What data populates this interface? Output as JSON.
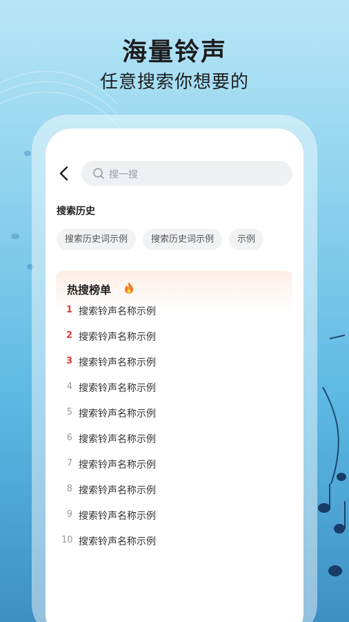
{
  "headline": "海量铃声",
  "subline": "任意搜索你想要的",
  "search": {
    "placeholder": "搜一搜"
  },
  "history": {
    "title": "搜索历史",
    "items": [
      "搜索历史词示例",
      "搜索历史词示例",
      "示例"
    ]
  },
  "hot": {
    "title": "热搜榜单",
    "items": [
      {
        "rank": "1",
        "name": "搜索铃声名称示例"
      },
      {
        "rank": "2",
        "name": "搜索铃声名称示例"
      },
      {
        "rank": "3",
        "name": "搜索铃声名称示例"
      },
      {
        "rank": "4",
        "name": "搜索铃声名称示例"
      },
      {
        "rank": "5",
        "name": "搜索铃声名称示例"
      },
      {
        "rank": "6",
        "name": "搜索铃声名称示例"
      },
      {
        "rank": "7",
        "name": "搜索铃声名称示例"
      },
      {
        "rank": "8",
        "name": "搜索铃声名称示例"
      },
      {
        "rank": "9",
        "name": "搜索铃声名称示例"
      },
      {
        "rank": "10",
        "name": "搜索铃声名称示例"
      }
    ]
  },
  "colors": {
    "rank_top": "#e53935",
    "rank_normal": "#999999",
    "accent_bg": "#8fd3ef"
  },
  "icons": {
    "back": "chevron-left-icon",
    "search": "search-icon",
    "hot": "fire-icon"
  }
}
